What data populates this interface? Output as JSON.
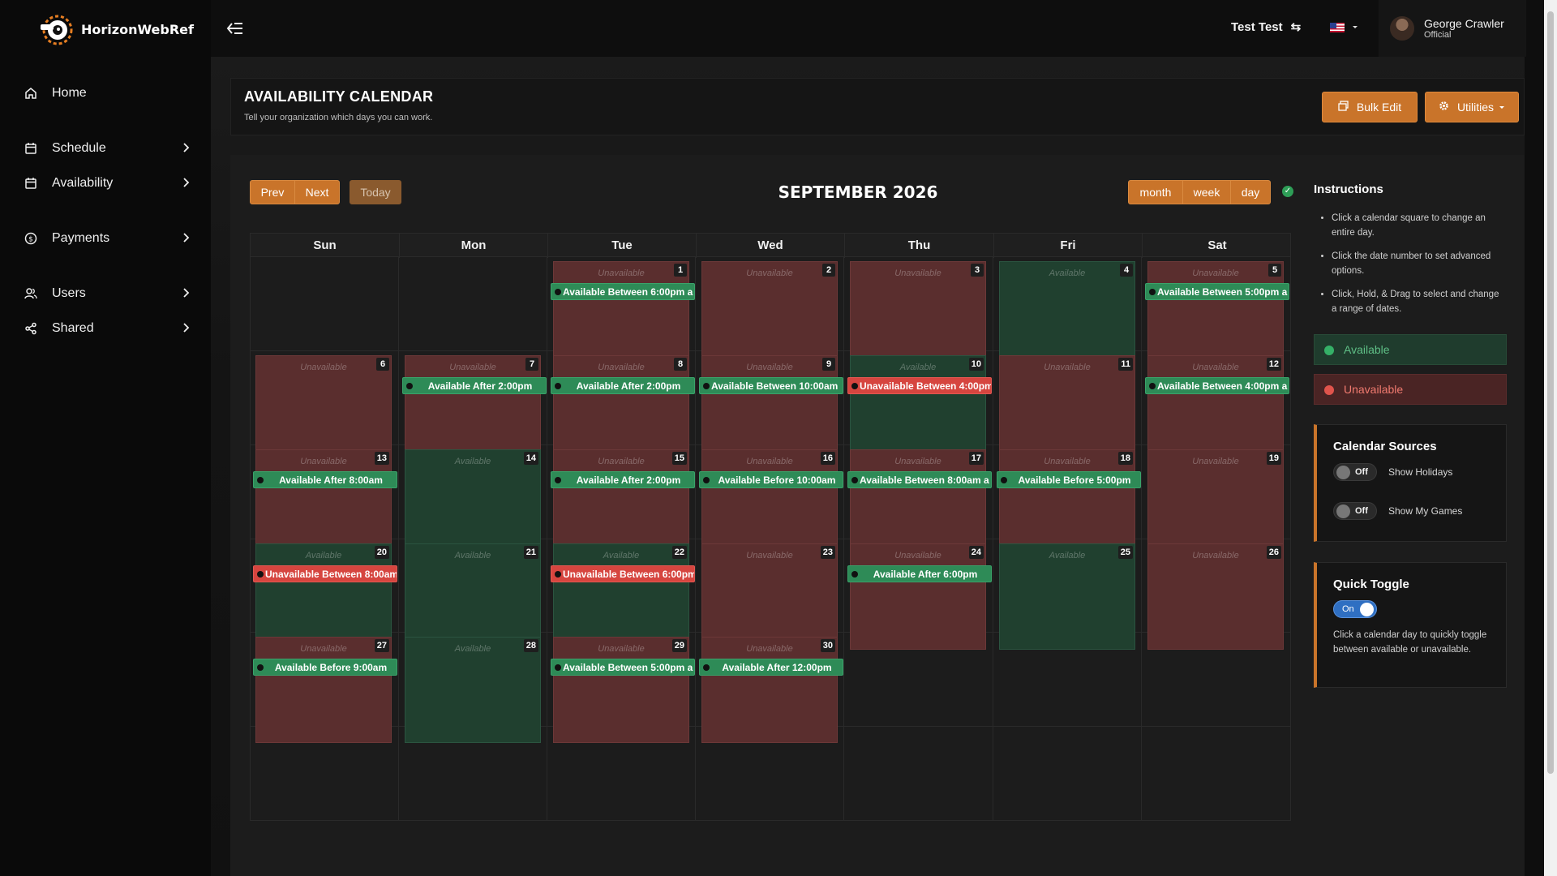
{
  "app": {
    "name": "HorizonWebRef"
  },
  "nav": [
    {
      "label": "Home",
      "icon": "home-icon"
    },
    {
      "label": "Schedule",
      "icon": "calendar-icon"
    },
    {
      "label": "Availability",
      "icon": "calendar-check-icon"
    },
    {
      "label": "Payments",
      "icon": "dollar-icon"
    },
    {
      "label": "Users",
      "icon": "users-icon"
    },
    {
      "label": "Shared",
      "icon": "share-icon"
    }
  ],
  "topbar": {
    "org": "Test Test",
    "user_name": "George Crawler",
    "user_role": "Official"
  },
  "header": {
    "title": "AVAILABILITY CALENDAR",
    "subtitle": "Tell your organization which days you can work.",
    "bulk_edit": "Bulk Edit",
    "utilities": "Utilities"
  },
  "calendar": {
    "prev": "Prev",
    "next": "Next",
    "today": "Today",
    "title": "SEPTEMBER 2026",
    "views": [
      "month",
      "week",
      "day"
    ],
    "weekdays": [
      "Sun",
      "Mon",
      "Tue",
      "Wed",
      "Thu",
      "Fri",
      "Sat"
    ],
    "first_weekday": 2,
    "days": [
      {
        "d": "1",
        "state": "Unavailable",
        "event": "Available Between 6:00pm a",
        "event_type": "green"
      },
      {
        "d": "2",
        "state": "Unavailable"
      },
      {
        "d": "3",
        "state": "Unavailable"
      },
      {
        "d": "4",
        "state": "Available"
      },
      {
        "d": "5",
        "state": "Unavailable",
        "event": "Available Between 5:00pm a",
        "event_type": "green"
      },
      {
        "d": "6",
        "state": "Unavailable"
      },
      {
        "d": "7",
        "state": "Unavailable",
        "event": "Available After 2:00pm",
        "event_type": "green"
      },
      {
        "d": "8",
        "state": "Unavailable",
        "event": "Available After 2:00pm",
        "event_type": "green"
      },
      {
        "d": "9",
        "state": "Unavailable",
        "event": "Available Between 10:00am",
        "event_type": "green"
      },
      {
        "d": "10",
        "state": "Available",
        "event": "Unavailable Between 4:00pm",
        "event_type": "red"
      },
      {
        "d": "11",
        "state": "Unavailable"
      },
      {
        "d": "12",
        "state": "Unavailable",
        "event": "Available Between 4:00pm a",
        "event_type": "green"
      },
      {
        "d": "13",
        "state": "Unavailable",
        "event": "Available After 8:00am",
        "event_type": "green"
      },
      {
        "d": "14",
        "state": "Available"
      },
      {
        "d": "15",
        "state": "Unavailable",
        "event": "Available After 2:00pm",
        "event_type": "green"
      },
      {
        "d": "16",
        "state": "Unavailable",
        "event": "Available Before 10:00am",
        "event_type": "green"
      },
      {
        "d": "17",
        "state": "Unavailable",
        "event": "Available Between 8:00am a",
        "event_type": "green"
      },
      {
        "d": "18",
        "state": "Unavailable",
        "event": "Available Before 5:00pm",
        "event_type": "green"
      },
      {
        "d": "19",
        "state": "Unavailable"
      },
      {
        "d": "20",
        "state": "Available",
        "event": "Unavailable Between 8:00am",
        "event_type": "red"
      },
      {
        "d": "21",
        "state": "Available"
      },
      {
        "d": "22",
        "state": "Available",
        "event": "Unavailable Between 6:00pm",
        "event_type": "red"
      },
      {
        "d": "23",
        "state": "Unavailable"
      },
      {
        "d": "24",
        "state": "Unavailable",
        "event": "Available After 6:00pm",
        "event_type": "green"
      },
      {
        "d": "25",
        "state": "Available"
      },
      {
        "d": "26",
        "state": "Unavailable"
      },
      {
        "d": "27",
        "state": "Unavailable",
        "event": "Available Before 9:00am",
        "event_type": "green"
      },
      {
        "d": "28",
        "state": "Available"
      },
      {
        "d": "29",
        "state": "Unavailable",
        "event": "Available Between 5:00pm a",
        "event_type": "green"
      },
      {
        "d": "30",
        "state": "Unavailable",
        "event": "Available After 12:00pm",
        "event_type": "green"
      }
    ]
  },
  "instructions": {
    "title": "Instructions",
    "items": [
      "Click a calendar square to change an entire day.",
      "Click the date number to set advanced options.",
      "Click, Hold, & Drag to select and change a range of dates."
    ]
  },
  "legend": {
    "available": "Available",
    "unavailable": "Unavailable"
  },
  "sources": {
    "title": "Calendar Sources",
    "holidays_toggle": "Off",
    "holidays_label": "Show Holidays",
    "games_toggle": "Off",
    "games_label": "Show My Games"
  },
  "quick_toggle": {
    "title": "Quick Toggle",
    "toggle": "On",
    "desc": "Click a calendar day to quickly toggle between available or unavailable."
  },
  "colors": {
    "accent": "#c9742a",
    "available": "#20402f",
    "unavailable": "#5a2e2e",
    "event_green": "#2e8b57",
    "event_red": "#d6453f"
  }
}
